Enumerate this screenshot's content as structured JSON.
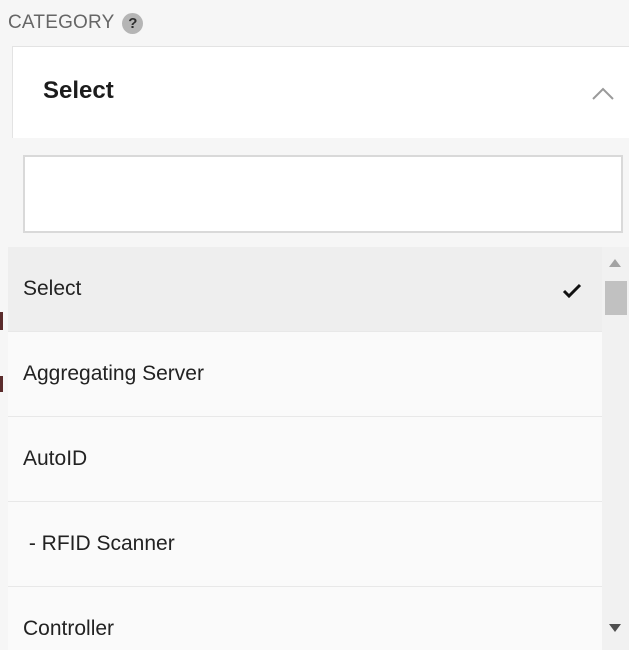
{
  "field": {
    "label": "CATEGORY",
    "help_glyph": "?"
  },
  "select": {
    "current_value": "Select",
    "icon": "chevron-up-icon"
  },
  "search": {
    "value": "",
    "placeholder": ""
  },
  "options": [
    {
      "label": "Select",
      "selected": true
    },
    {
      "label": "Aggregating Server",
      "selected": false
    },
    {
      "label": "AutoID",
      "selected": false
    },
    {
      "label": " - RFID Scanner",
      "selected": false
    },
    {
      "label": "Controller",
      "selected": false
    }
  ],
  "colors": {
    "selected_row": "#eeeeee",
    "row": "#fafafa",
    "text": "#222222",
    "label": "#666666"
  }
}
